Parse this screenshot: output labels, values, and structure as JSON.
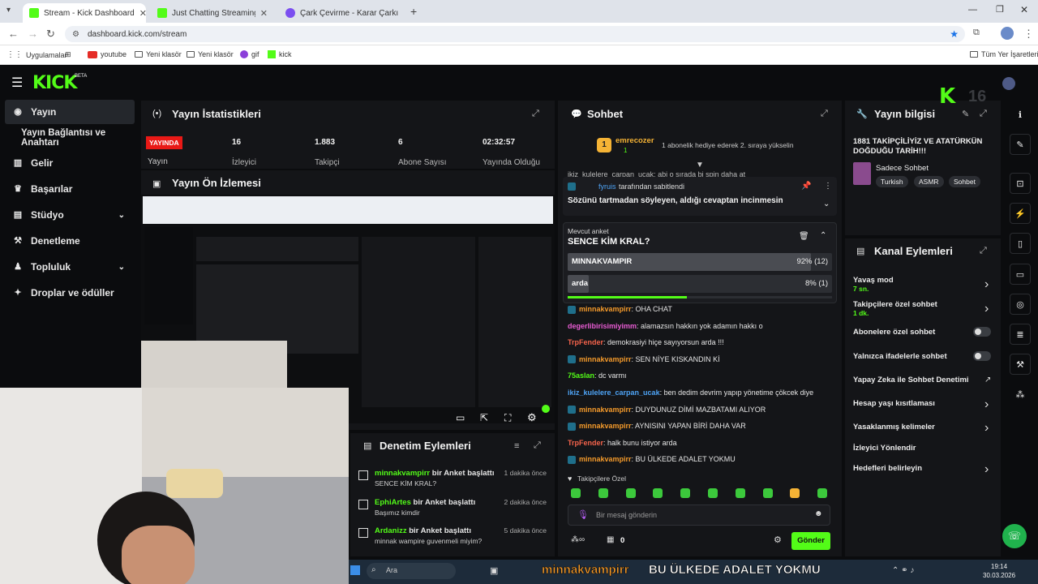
{
  "browser": {
    "tabs": [
      {
        "title": "Stream - Kick Dashboard",
        "fav": "#53fc18"
      },
      {
        "title": "Just Chatting Streaming - Live S",
        "fav": "#53fc18"
      },
      {
        "title": "Çark Çevirme - Karar Çarkı",
        "fav": "#7b4ef0"
      }
    ],
    "url": "dashboard.kick.com/stream",
    "bookmarks": [
      "Uygulamalar",
      "youtube",
      "Yeni klasör",
      "Yeni klasör",
      "gif",
      "kick"
    ],
    "all_bookmarks": "Tüm Yer İşaretleri"
  },
  "kick": {
    "logo": "KICK",
    "beta": "BETA"
  },
  "sidebar": {
    "items": [
      {
        "label": "Yayın",
        "icon": "broadcast-icon"
      },
      {
        "label": "Yayın Bağlantısı ve Anahtarı",
        "icon": ""
      },
      {
        "label": "Gelir",
        "icon": "revenue-icon"
      },
      {
        "label": "Başarılar",
        "icon": "achievement-icon"
      },
      {
        "label": "Stüdyo",
        "icon": "studio-icon"
      },
      {
        "label": "Denetleme",
        "icon": "moderation-icon"
      },
      {
        "label": "Topluluk",
        "icon": "community-icon"
      },
      {
        "label": "Droplar ve ödüller",
        "icon": "drops-icon"
      }
    ]
  },
  "stats": {
    "title": "Yayın İstatistikleri",
    "live_badge": "YAYINDA",
    "live_label": "Yayın",
    "items": [
      {
        "value": "16",
        "label": "İzleyici"
      },
      {
        "value": "1.883",
        "label": "Takipçi"
      },
      {
        "value": "6",
        "label": "Abone Sayısı"
      },
      {
        "value": "02:32:57",
        "label": "Yayında Olduğu"
      }
    ]
  },
  "preview": {
    "title": "Yayın Ön İzlemesi"
  },
  "chat": {
    "title": "Sohbet",
    "gift": {
      "user": "emrecozer",
      "count": "1",
      "text": "1 abonelik hediye ederek 2. sıraya yükselin"
    },
    "partial_line": "ikiz_kulelere_carpan_ucak: abi o sırada bi spin daha at",
    "pinned": {
      "by": "fyruis",
      "by_suffix": "tarafından sabitlendi",
      "text": "Sözünü tartmadan söyleyen, aldığı cevaptan incinmesin"
    },
    "poll": {
      "label": "Mevcut anket",
      "question": "SENCE KİM KRAL?",
      "options": [
        {
          "name": "MINNAKVAMPIR",
          "result": "92% (12)",
          "fraction": 0.92
        },
        {
          "name": "arda",
          "result": "8% (1)",
          "fraction": 0.08
        }
      ],
      "timer_fraction": 0.45
    },
    "messages": [
      {
        "user": "minnakvampirr",
        "color": "#f49a2b",
        "text": "OHA CHAT",
        "badge": true
      },
      {
        "user": "degerlibirisimiyimm",
        "color": "#e85cd3",
        "text": "alamazsın hakkın yok adamın hakkı o",
        "badge": false
      },
      {
        "user": "TrpFender",
        "color": "#f4634b",
        "text": "demokrasiyi hiçe sayıyorsun arda !!!",
        "badge": false
      },
      {
        "user": "minnakvampirr",
        "color": "#f49a2b",
        "text": "SEN NİYE KISKANDIN Kİ",
        "badge": true
      },
      {
        "user": "75aslan",
        "color": "#53fc18",
        "text": "dc varmı",
        "badge": false
      },
      {
        "user": "ikiz_kulelere_carpan_ucak",
        "color": "#4ea3f5",
        "text": "ben dedim devrim yapıp yönetime çökcek diye",
        "badge": false
      },
      {
        "user": "minnakvampirr",
        "color": "#f49a2b",
        "text": "DUYDUNUZ DİMİ MAZBATAMI ALIYOR",
        "badge": true
      },
      {
        "user": "minnakvampirr",
        "color": "#f49a2b",
        "text": "AYNISINI YAPAN BİRİ DAHA VAR",
        "badge": true
      },
      {
        "user": "TrpFender",
        "color": "#f4634b",
        "text": "halk bunu istiyor arda",
        "badge": false
      },
      {
        "user": "minnakvampirr",
        "color": "#f49a2b",
        "text": "BU ÜLKEDE ADALET YOKMU",
        "badge": true
      }
    ],
    "followers_only": "Takipçilere Özel",
    "input_placeholder": "Bir mesaj gönderin",
    "points": "0",
    "send": "Gönder"
  },
  "info": {
    "title": "Yayın bilgisi",
    "stream_title": "1881 TAKİPÇİLİYİZ VE ATATÜRKÜN DOĞDUĞU TARİH!!!",
    "category": "Sadece Sohbet",
    "tags": [
      "Turkish",
      "ASMR",
      "Sohbet"
    ]
  },
  "channel_actions": {
    "title": "Kanal Eylemleri",
    "items": [
      {
        "label": "Yavaş mod",
        "sub": "7 sn.",
        "control": "arrow"
      },
      {
        "label": "Takipçilere özel sohbet",
        "sub": "1 dk.",
        "control": "arrow"
      },
      {
        "label": "Abonelere özel sohbet",
        "sub": "",
        "control": "toggle"
      },
      {
        "label": "Yalnızca ifadelerle sohbet",
        "sub": "",
        "control": "toggle"
      },
      {
        "label": "Yapay Zeka ile Sohbet Denetimi",
        "sub": "",
        "control": "external"
      },
      {
        "label": "Hesap yaşı kısıtlaması",
        "sub": "",
        "control": "arrow"
      },
      {
        "label": "Yasaklanmış kelimeler",
        "sub": "",
        "control": "arrow"
      },
      {
        "label": "İzleyici Yönlendir",
        "sub": "",
        "control": "none"
      },
      {
        "label": "Hedefleri belirleyin",
        "sub": "",
        "control": "arrow"
      }
    ]
  },
  "moderation": {
    "title": "Denetim Eylemleri",
    "items": [
      {
        "user": "minnakvampirr",
        "action": "bir Anket başlattı",
        "sub": "SENCE KİM KRAL?",
        "time": "1 dakika önce"
      },
      {
        "user": "EphiArtes",
        "action": "bir Anket başlattı",
        "sub": "Başımız kimdir",
        "time": "2 dakika önce"
      },
      {
        "user": "Ardanizz",
        "action": "bir Anket başlattı",
        "sub": "minnak wampire guvenmeli miyim?",
        "time": "5 dakika önce"
      }
    ]
  },
  "overlay": {
    "user": "minnakvampirr",
    "text": "BU ÜLKEDE ADALET YOKMU",
    "k_logo": "K",
    "viewer_count": "16"
  },
  "taskbar": {
    "search": "Ara",
    "time": "19:14",
    "date": "30.03.2026"
  },
  "colors": {
    "accent": "#53fc18",
    "bg": "#0b0c0e",
    "panel": "#141518",
    "live": "#e91916"
  }
}
